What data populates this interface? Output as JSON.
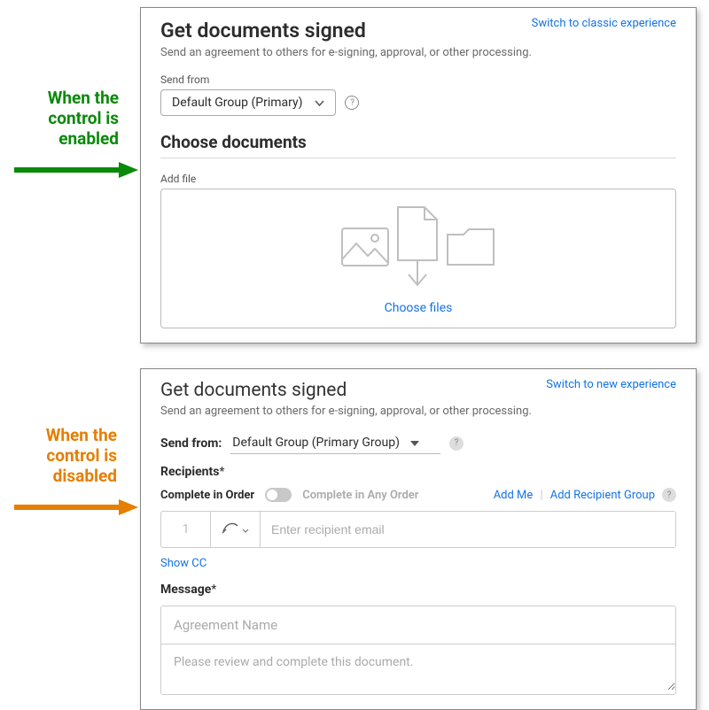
{
  "annotations": {
    "enabled": "When the control is enabled",
    "disabled": "When the control is disabled"
  },
  "panel1": {
    "switchLink": "Switch to classic experience",
    "title": "Get documents signed",
    "subtitle": "Send an agreement to others for e-signing, approval, or other processing.",
    "sendFromLabel": "Send from",
    "sendFromValue": "Default Group (Primary)",
    "chooseDocsHeading": "Choose documents",
    "addFileLabel": "Add file",
    "chooseFiles": "Choose files"
  },
  "panel2": {
    "switchLink": "Switch to new experience",
    "title": "Get documents signed",
    "subtitle": "Send an agreement to others for e-signing, approval, or other processing.",
    "sendFromLabel": "Send from:",
    "sendFromValue": "Default Group (Primary Group)",
    "recipientsHeading": "Recipients",
    "completeInOrder": "Complete in Order",
    "completeAnyOrder": "Complete in Any Order",
    "addMe": "Add Me",
    "addRecipientGroup": "Add Recipient Group",
    "rowNumber": "1",
    "recipientPlaceholder": "Enter recipient email",
    "showCC": "Show CC",
    "messageHeading": "Message",
    "agreementName": "Agreement Name",
    "agreementBody": "Please review and complete this document."
  }
}
